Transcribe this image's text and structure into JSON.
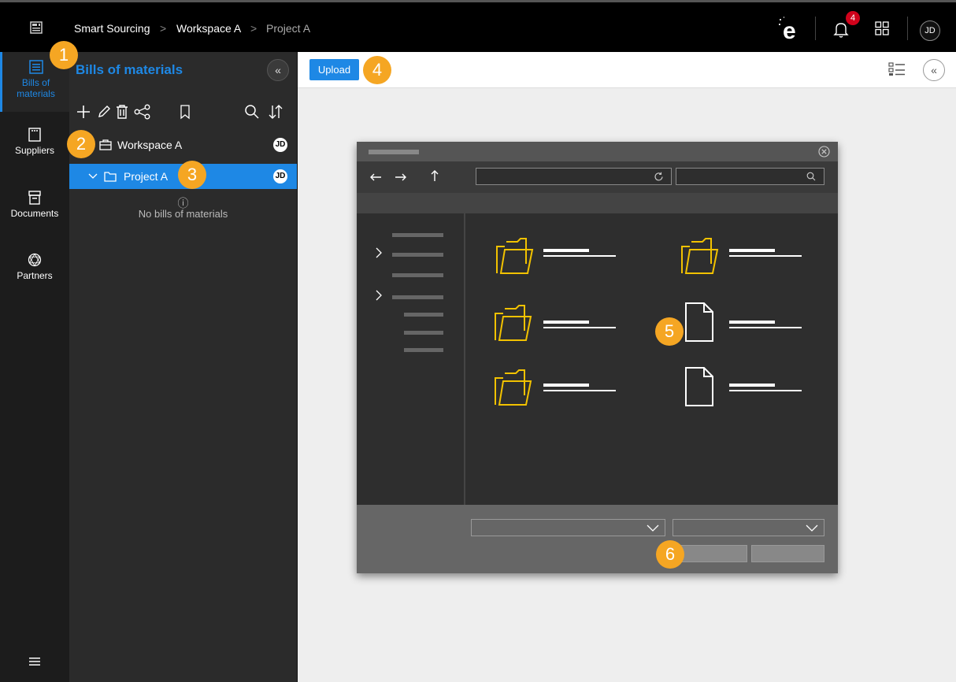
{
  "breadcrumb": {
    "items": [
      "Smart Sourcing",
      "Workspace A",
      "Project A"
    ],
    "separator": ">"
  },
  "topbar": {
    "notification_count": "4",
    "user_initials": "JD"
  },
  "leftnav": {
    "items": [
      {
        "label": "Bills of materials",
        "icon": "bom-icon",
        "active": true
      },
      {
        "label": "Suppliers",
        "icon": "suppliers-icon"
      },
      {
        "label": "Documents",
        "icon": "archive-icon"
      },
      {
        "label": "Partners",
        "icon": "network-icon"
      }
    ]
  },
  "panel": {
    "title": "Bills of materials",
    "collapse_label": "«",
    "tree": [
      {
        "label": "Workspace A",
        "owner": "JD"
      },
      {
        "label": "Project A",
        "owner": "JD",
        "selected": true
      }
    ],
    "empty_text": "No bills of materials",
    "info_glyph": "ⓘ"
  },
  "main": {
    "upload_label": "Upload",
    "collapse_label": "«"
  },
  "callouts": [
    "1",
    "2",
    "3",
    "4",
    "5",
    "6"
  ],
  "colors": {
    "accent": "#1e88e5",
    "callout": "#f5a623",
    "folder": "#f2c200",
    "badge": "#d0021b"
  }
}
